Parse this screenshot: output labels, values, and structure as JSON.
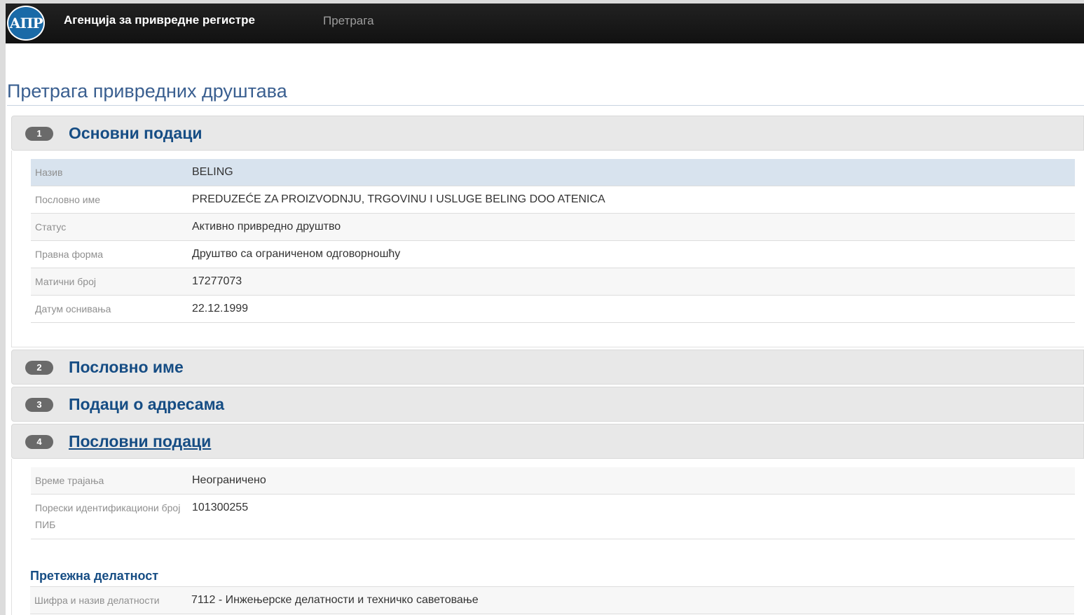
{
  "navbar": {
    "logo_text": "АПР",
    "brand": "Агенција за привредне регистре",
    "search_link": "Претрага"
  },
  "page_title": "Претрага привредних друштава",
  "sections": [
    {
      "number": "1",
      "title": "Основни подаци"
    },
    {
      "number": "2",
      "title": "Пословно име"
    },
    {
      "number": "3",
      "title": "Подаци о адресама"
    },
    {
      "number": "4",
      "title": "Пословни подаци"
    }
  ],
  "basic_data": [
    {
      "label": "Назив",
      "value": "BELING"
    },
    {
      "label": "Пословно име",
      "value": "PREDUZEĆE ZA PROIZVODNJU, TRGOVINU I USLUGE BELING DOO ATENICA"
    },
    {
      "label": "Статус",
      "value": "Активно привредно друштво"
    },
    {
      "label": "Правна форма",
      "value": "Друштво са ограниченом одговорношћу"
    },
    {
      "label": "Матични број",
      "value": "17277073"
    },
    {
      "label": "Датум оснивања",
      "value": "22.12.1999"
    }
  ],
  "business_data": [
    {
      "label": "Време трајања",
      "value": "Неограничено"
    },
    {
      "label": "Порески идентификациони број ПИБ",
      "value": "101300255"
    }
  ],
  "activity": {
    "heading": "Претежна делатност",
    "label": "Шифра и назив делатности",
    "value": "7112 - Инжењерске делатности и техничко саветовање"
  }
}
